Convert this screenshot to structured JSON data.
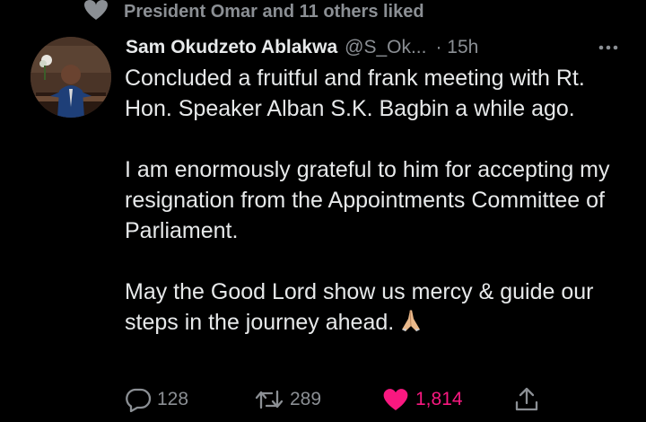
{
  "social_context": {
    "text": "President Omar and 11 others liked"
  },
  "tweet": {
    "display_name": "Sam Okudzeto Ablakwa",
    "handle": "@S_Ok...",
    "time": "· 15h",
    "paragraphs": [
      "Concluded a fruitful and frank meeting with Rt. Hon. Speaker Alban S.K. Bagbin a while ago.",
      "I am enormously grateful to him for accepting my resignation from the Appointments Committee of Parliament.",
      "May the Good Lord show us mercy & guide our steps in the journey ahead."
    ]
  },
  "actions": {
    "replies": "128",
    "retweets": "289",
    "likes": "1,814"
  },
  "colors": {
    "background": "#000000",
    "text": "#e7e9ea",
    "muted": "#8b8f94",
    "like": "#f91880"
  },
  "icons": [
    "heart-icon",
    "more-icon",
    "pray-emoji",
    "reply-icon",
    "retweet-icon",
    "like-icon",
    "share-icon"
  ]
}
